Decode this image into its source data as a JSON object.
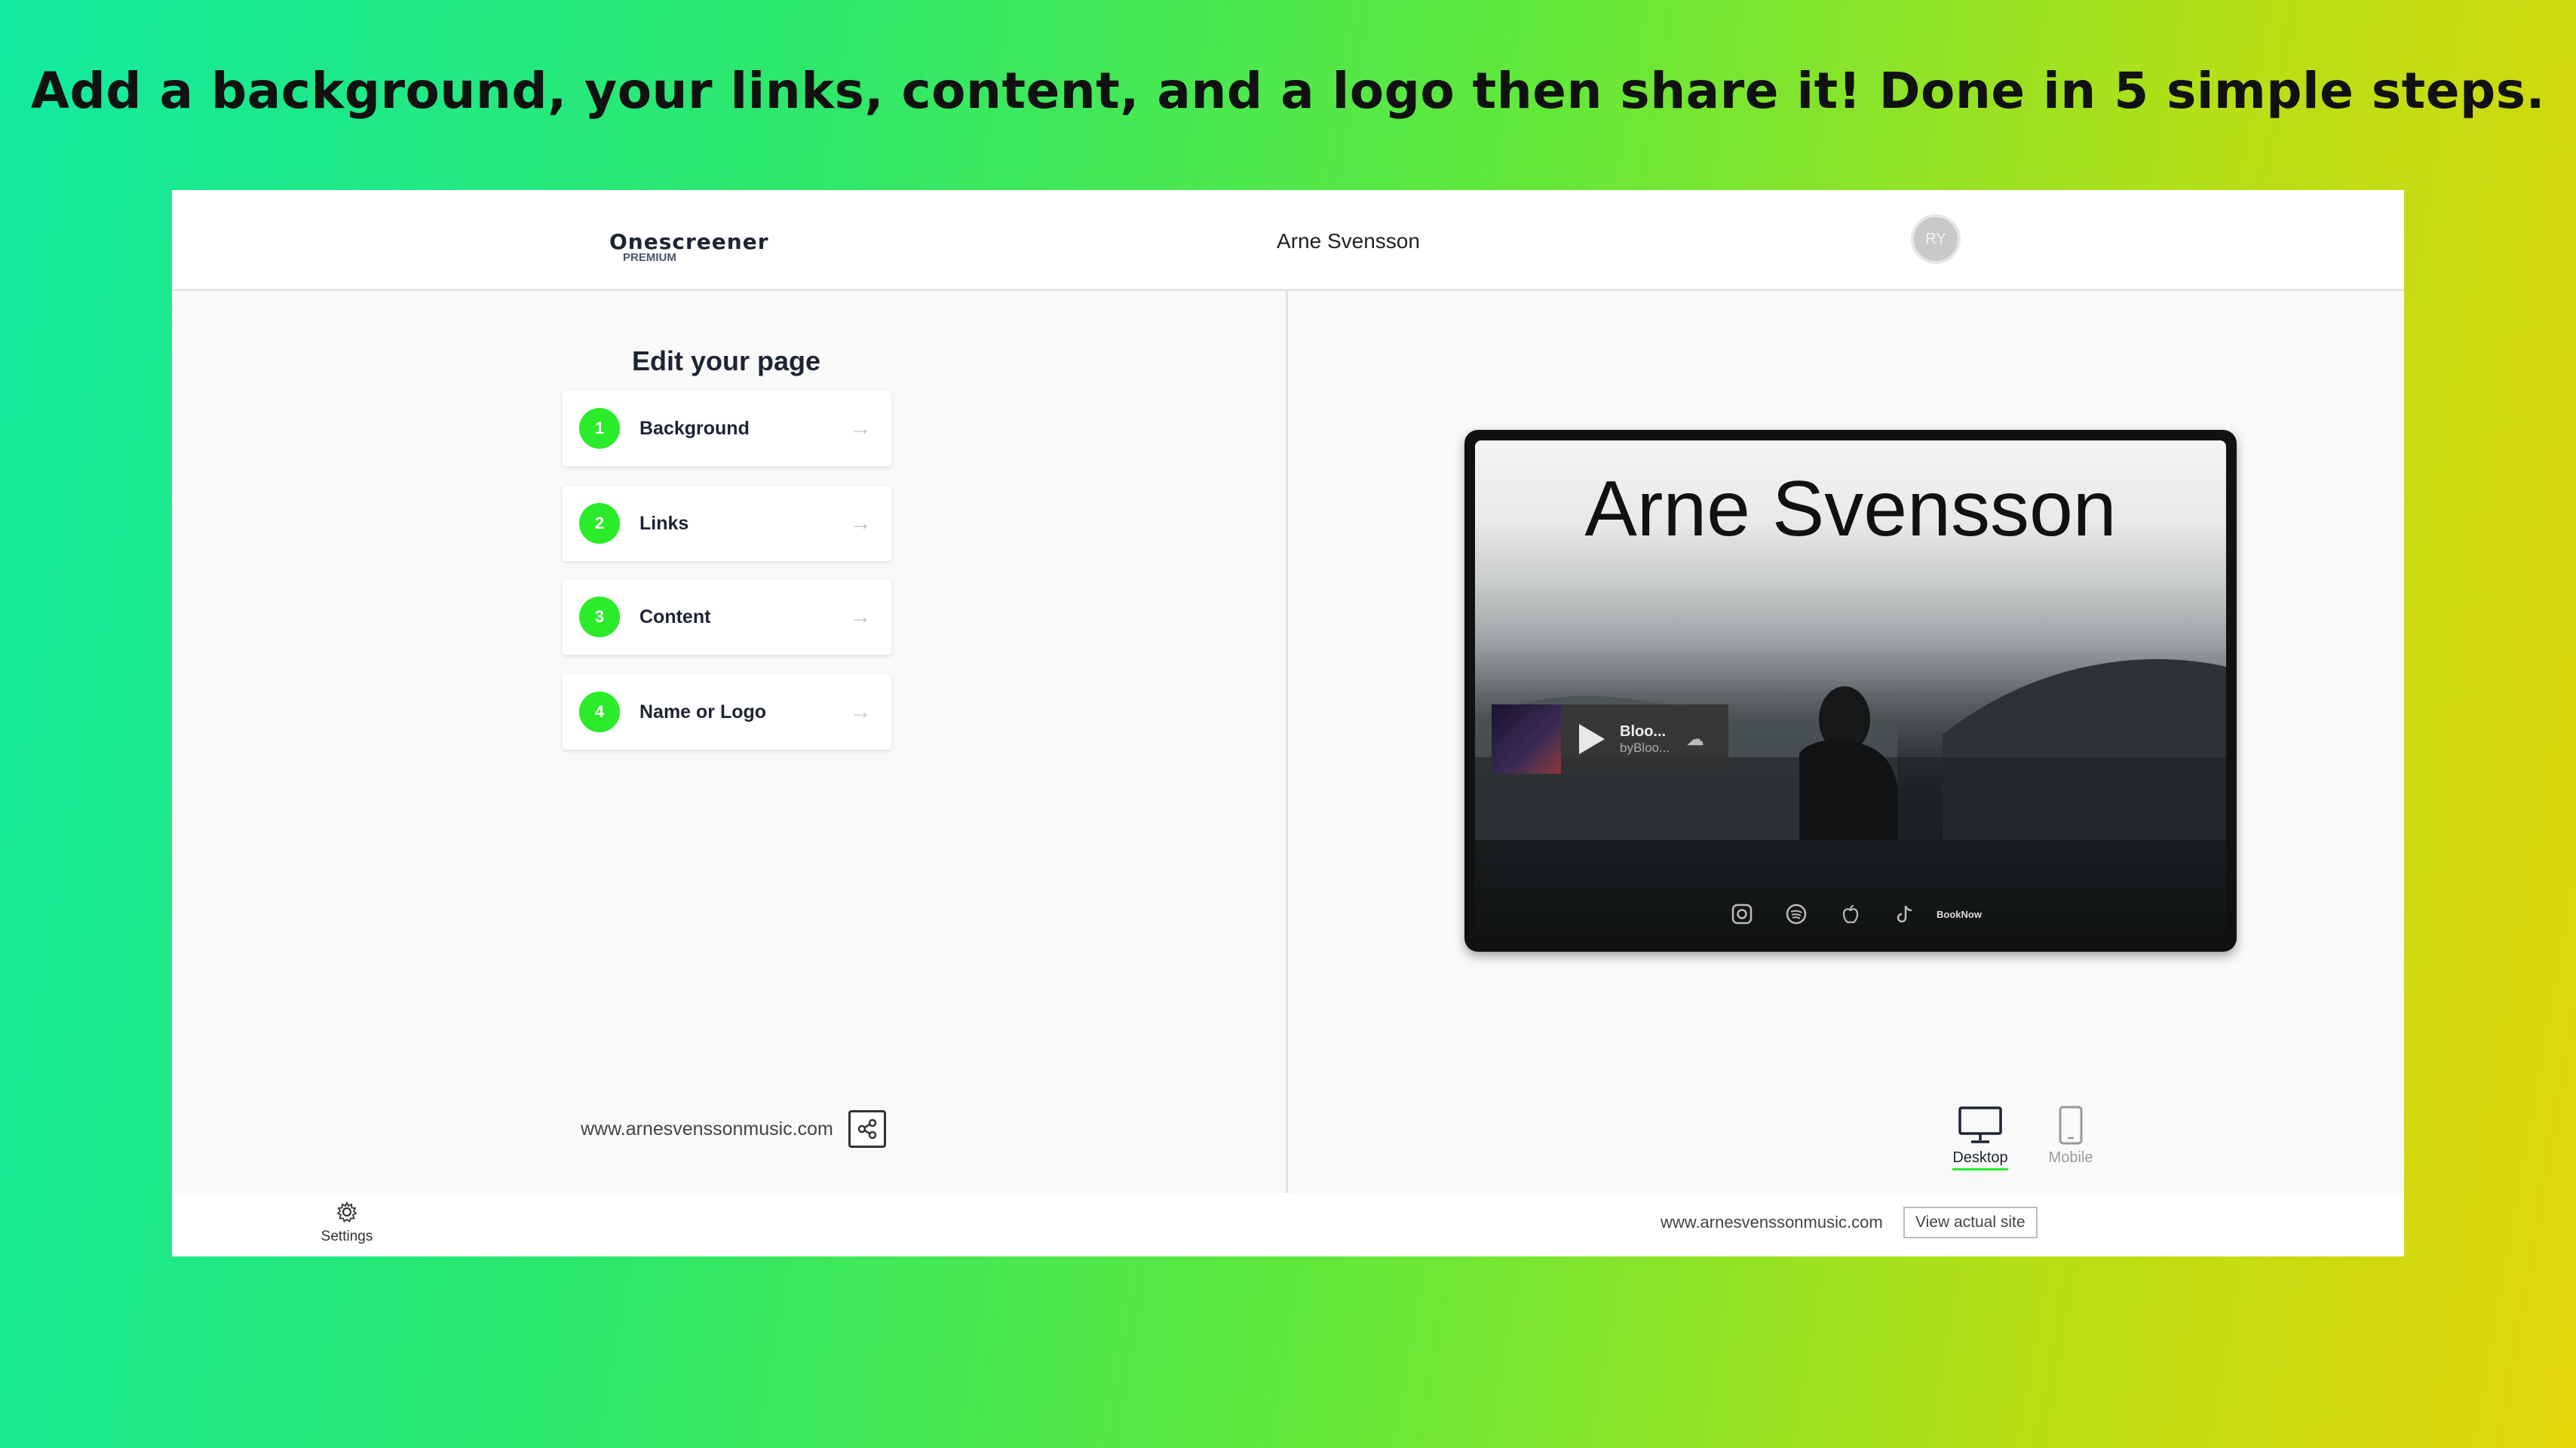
{
  "headline": "Add a background, your links, content, and a logo then share it! Done in 5 simple steps.",
  "topbar": {
    "brand_name": "Onescreener",
    "brand_tier": "PREMIUM",
    "site_name": "Arne Svensson",
    "avatar_initials": "RY"
  },
  "editor": {
    "title": "Edit your page",
    "steps": [
      {
        "num": "1",
        "label": "Background"
      },
      {
        "num": "2",
        "label": "Links"
      },
      {
        "num": "3",
        "label": "Content"
      },
      {
        "num": "4",
        "label": "Name or Logo"
      }
    ],
    "url": "www.arnesvenssonmusic.com"
  },
  "preview": {
    "title": "Arne Svensson",
    "player": {
      "title": "Bloo...",
      "artist": "byBloo..."
    },
    "socials": [
      "instagram-icon",
      "spotify-icon",
      "apple-icon",
      "tiktok-icon"
    ],
    "book_label_1": "Book",
    "book_label_2": "Now"
  },
  "devices": {
    "desktop": "Desktop",
    "mobile": "Mobile",
    "active": "Desktop"
  },
  "bottombar": {
    "settings": "Settings",
    "url": "www.arnesvenssonmusic.com",
    "view_site": "View actual site"
  },
  "colors": {
    "accent": "#2aec2a",
    "text_dark": "#1d2433"
  }
}
